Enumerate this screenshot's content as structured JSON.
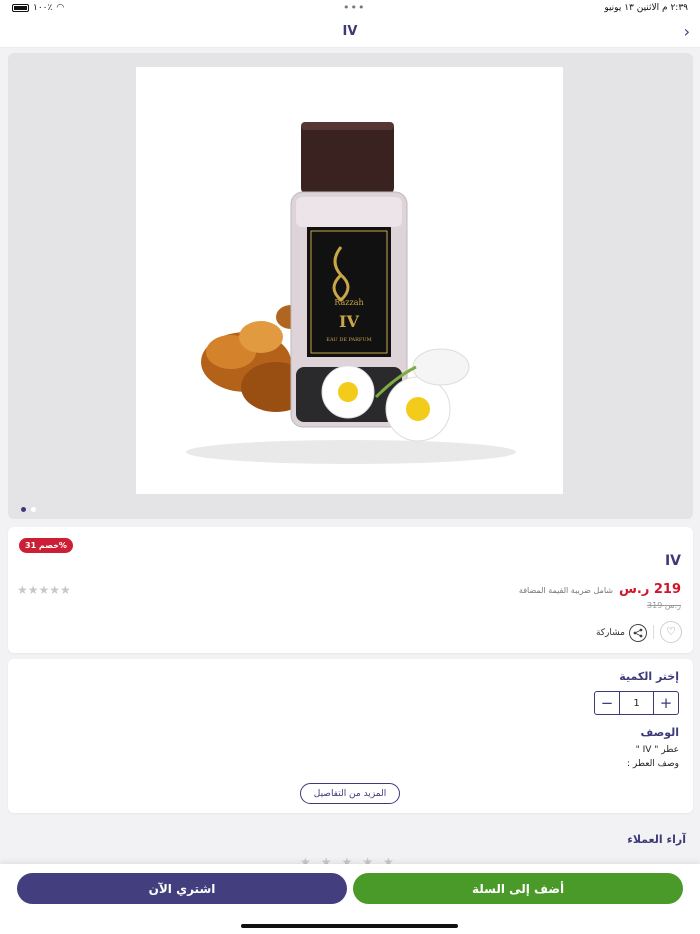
{
  "status_bar": {
    "time_date": "٢:٣٩ م   الاثنين ١٣ يونيو",
    "battery": "١٠٠٪",
    "center_dots": "•••"
  },
  "nav": {
    "title": "IV",
    "back_icon": "chevron-right-icon"
  },
  "gallery": {
    "image_alt": "Razzah IV perfume bottle with flowers and caramel",
    "bottle_brand": "Razzah",
    "bottle_label": "IV",
    "bottle_subtext": "EAU DE PARFUM",
    "slides": 2,
    "active_slide": 1
  },
  "product": {
    "discount_badge": "خصم 31%",
    "name": "IV",
    "price": "219 ر.س",
    "vat_note": "شامل ضريبة القيمة المضافة",
    "old_price": "319 ر.س",
    "rating_stars": "★★★★★",
    "share_label": "مشاركة"
  },
  "quantity": {
    "title": "إختر الكمية",
    "value": "1",
    "plus": "+",
    "minus": "−"
  },
  "description": {
    "title": "الوصف",
    "line1": "عطر \" IV \"",
    "line2": "وصف العطر :",
    "more_button": "المزيد من التفاصيل"
  },
  "reviews": {
    "title": "آراء العملاء",
    "stars": "★★★★★"
  },
  "actions": {
    "buy_now": "اشتري الآن",
    "add_to_cart": "أضف إلى السلة"
  },
  "colors": {
    "brand": "#3d3a7a",
    "price": "#d2142b",
    "cart": "#4a9a2a"
  }
}
